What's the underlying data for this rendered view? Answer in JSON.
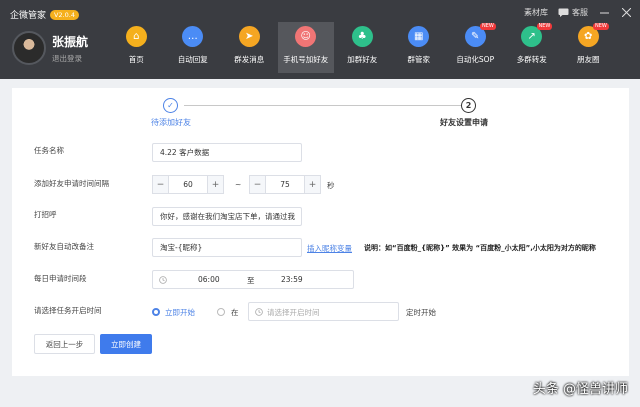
{
  "app": {
    "title": "企微管家",
    "version": "V2.0.4",
    "material_label": "素材库",
    "service_label": "客服"
  },
  "user": {
    "name": "张振航",
    "logout_label": "退出登录"
  },
  "nav": {
    "items": [
      {
        "label": "首页",
        "icon": "home-icon",
        "color": "#f5b01d",
        "glyph": "⌂",
        "new": ""
      },
      {
        "label": "自动回复",
        "icon": "chat-bubble-icon",
        "color": "#4b8cf5",
        "glyph": "…",
        "new": ""
      },
      {
        "label": "群发消息",
        "icon": "send-icon",
        "color": "#f5a623",
        "glyph": "➤",
        "new": ""
      },
      {
        "label": "手机号加好友",
        "icon": "add-contact-icon",
        "color": "#f07575",
        "glyph": "☺",
        "new": ""
      },
      {
        "label": "加群好友",
        "icon": "group-icon",
        "color": "#2ec08b",
        "glyph": "♣",
        "new": ""
      },
      {
        "label": "群管家",
        "icon": "grid-icon",
        "color": "#4b8cf5",
        "glyph": "▦",
        "new": ""
      },
      {
        "label": "自动化SOP",
        "icon": "sop-icon",
        "color": "#4b8cf5",
        "glyph": "✎",
        "new": "NEW"
      },
      {
        "label": "多群转发",
        "icon": "forward-icon",
        "color": "#2ec08b",
        "glyph": "↗",
        "new": "NEW"
      },
      {
        "label": "朋友圈",
        "icon": "moments-icon",
        "color": "#f5a623",
        "glyph": "✿",
        "new": "NEW"
      }
    ],
    "active_index": 3
  },
  "steps": {
    "step1_label": "待添加好友",
    "step1_glyph": "✓",
    "step2_number": "2",
    "step2_label": "好友设置申请"
  },
  "form": {
    "task_name": {
      "label": "任务名称",
      "value": "4.22 客户数据"
    },
    "interval": {
      "label": "添加好友申请时间间隔",
      "min_value": "60",
      "max_value": "75",
      "separator": "~",
      "unit": "秒",
      "minus": "−",
      "plus": "+"
    },
    "greeting": {
      "label": "打招呼",
      "value": "你好，感谢在我们淘宝店下单，请通过我"
    },
    "remark": {
      "label": "新好友自动改备注",
      "value": "淘宝-{昵称}",
      "insert_link": "插入昵称变量",
      "note": "说明：如“百度粉_{昵称}” 效果为 “百度粉_小太阳”,小太阳为对方的昵称"
    },
    "daily_time": {
      "label": "每日申请时间段",
      "start": "06:00",
      "to_label": "至",
      "end": "23:59"
    },
    "start_time": {
      "label": "请选择任务开启时间",
      "option_now": "立即开始",
      "option_at": "在",
      "placeholder": "请选择开启时间",
      "suffix": "定时开始"
    }
  },
  "buttons": {
    "back": "返回上一步",
    "create": "立即创建"
  },
  "watermark": "头条 @怪兽讲师"
}
